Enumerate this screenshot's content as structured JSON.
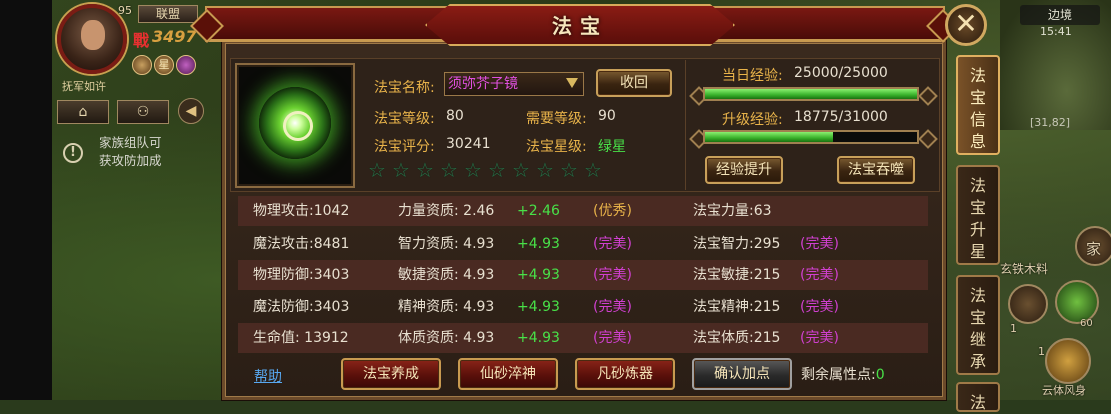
{
  "hud": {
    "level": "95",
    "alliance_label": "联盟",
    "power_icon": "戰",
    "power_value": "3497",
    "star_label": "星",
    "guild_name": "抚军如许",
    "notice_icon": "!",
    "notice_line1": "家族组队可",
    "notice_line2": "获攻防加成"
  },
  "minimap": {
    "name": "边境",
    "time": "15:41",
    "coords": "[31,82]"
  },
  "right_hud": {
    "family_label": "家",
    "item_label": "玄铁木料",
    "item_count": "1",
    "potion_count": "60",
    "skill_label": "云体风身",
    "skill_count": "1"
  },
  "panel": {
    "title": "法宝",
    "close_label": "✕",
    "name_label": "法宝名称:",
    "name_value": "须弥芥子镜",
    "recycle_button": "收回",
    "level_label": "法宝等级:",
    "level_value": "80",
    "req_level_label": "需要等级:",
    "req_level_value": "90",
    "score_label": "法宝评分:",
    "score_value": "30241",
    "star_label": "法宝星级:",
    "star_value": "绿星",
    "stars_total": 10,
    "daily_exp_label": "当日经验:",
    "daily_exp_value": "25000/25000",
    "daily_exp_fraction": 1.0,
    "upgrade_exp_label": "升级经验:",
    "upgrade_exp_value": "18775/31000",
    "upgrade_exp_fraction": 0.6056,
    "exp_boost_button": "经验提升",
    "devour_button": "法宝吞噬",
    "help_link": "帮助",
    "cultivate_button": "法宝养成",
    "immortal_sand_button": "仙砂淬神",
    "mortal_sand_button": "凡砂炼器",
    "confirm_button": "确认加点",
    "remaining_label": "剩余属性点:",
    "remaining_value": "0"
  },
  "stats": [
    {
      "attr": "物理攻击:1042",
      "apt": "力量资质: 2.46",
      "bonus": "+2.46",
      "grade": "(优秀)",
      "trait": "法宝力量:63",
      "trait_grade": ""
    },
    {
      "attr": "魔法攻击:8481",
      "apt": "智力资质: 4.93",
      "bonus": "+4.93",
      "grade": "(完美)",
      "trait": "法宝智力:295",
      "trait_grade": "(完美)"
    },
    {
      "attr": "物理防御:3403",
      "apt": "敏捷资质: 4.93",
      "bonus": "+4.93",
      "grade": "(完美)",
      "trait": "法宝敏捷:215",
      "trait_grade": "(完美)"
    },
    {
      "attr": "魔法防御:3403",
      "apt": "精神资质: 4.93",
      "bonus": "+4.93",
      "grade": "(完美)",
      "trait": "法宝精神:215",
      "trait_grade": "(完美)"
    },
    {
      "attr": "生命值: 13912",
      "apt": "体质资质: 4.93",
      "bonus": "+4.93",
      "grade": "(完美)",
      "trait": "法宝体质:215",
      "trait_grade": "(完美)"
    }
  ],
  "tabs": [
    {
      "label": "法宝信息"
    },
    {
      "label": "法宝升星"
    },
    {
      "label": "法宝继承"
    },
    {
      "label": "法"
    }
  ],
  "colors": {
    "accent": "#e8b34a",
    "green": "#48e048",
    "purple": "#d040d0",
    "panel": "#2a1e15"
  }
}
